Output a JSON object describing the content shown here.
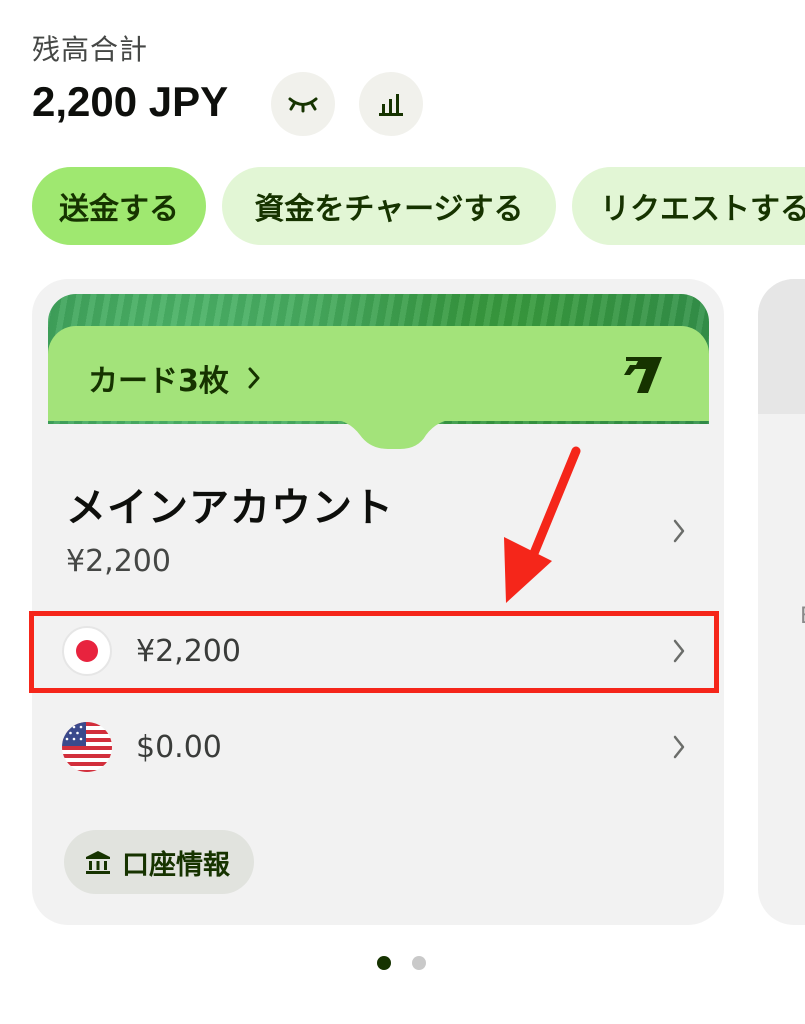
{
  "header": {
    "balance_label": "残高合計",
    "balance_amount": "2,200 JPY"
  },
  "actions": [
    {
      "label": "送金する"
    },
    {
      "label": "資金をチャージする"
    },
    {
      "label": "リクエストする"
    }
  ],
  "card": {
    "cards_link": "カード3枚",
    "account_title": "メインアカウント",
    "account_total": "¥2,200",
    "balances": [
      {
        "currency_flag": "jp-flag-icon",
        "amount": "¥2,200"
      },
      {
        "currency_flag": "us-flag-icon",
        "amount": "$0.00"
      }
    ],
    "details_button": "口座情報"
  },
  "pager": {
    "count": 2,
    "active_index": 0
  },
  "colors": {
    "brand_green": "#9fe870",
    "light_green": "#e2f6d5",
    "forest": "#163300",
    "annotation_red": "#f5261a"
  }
}
